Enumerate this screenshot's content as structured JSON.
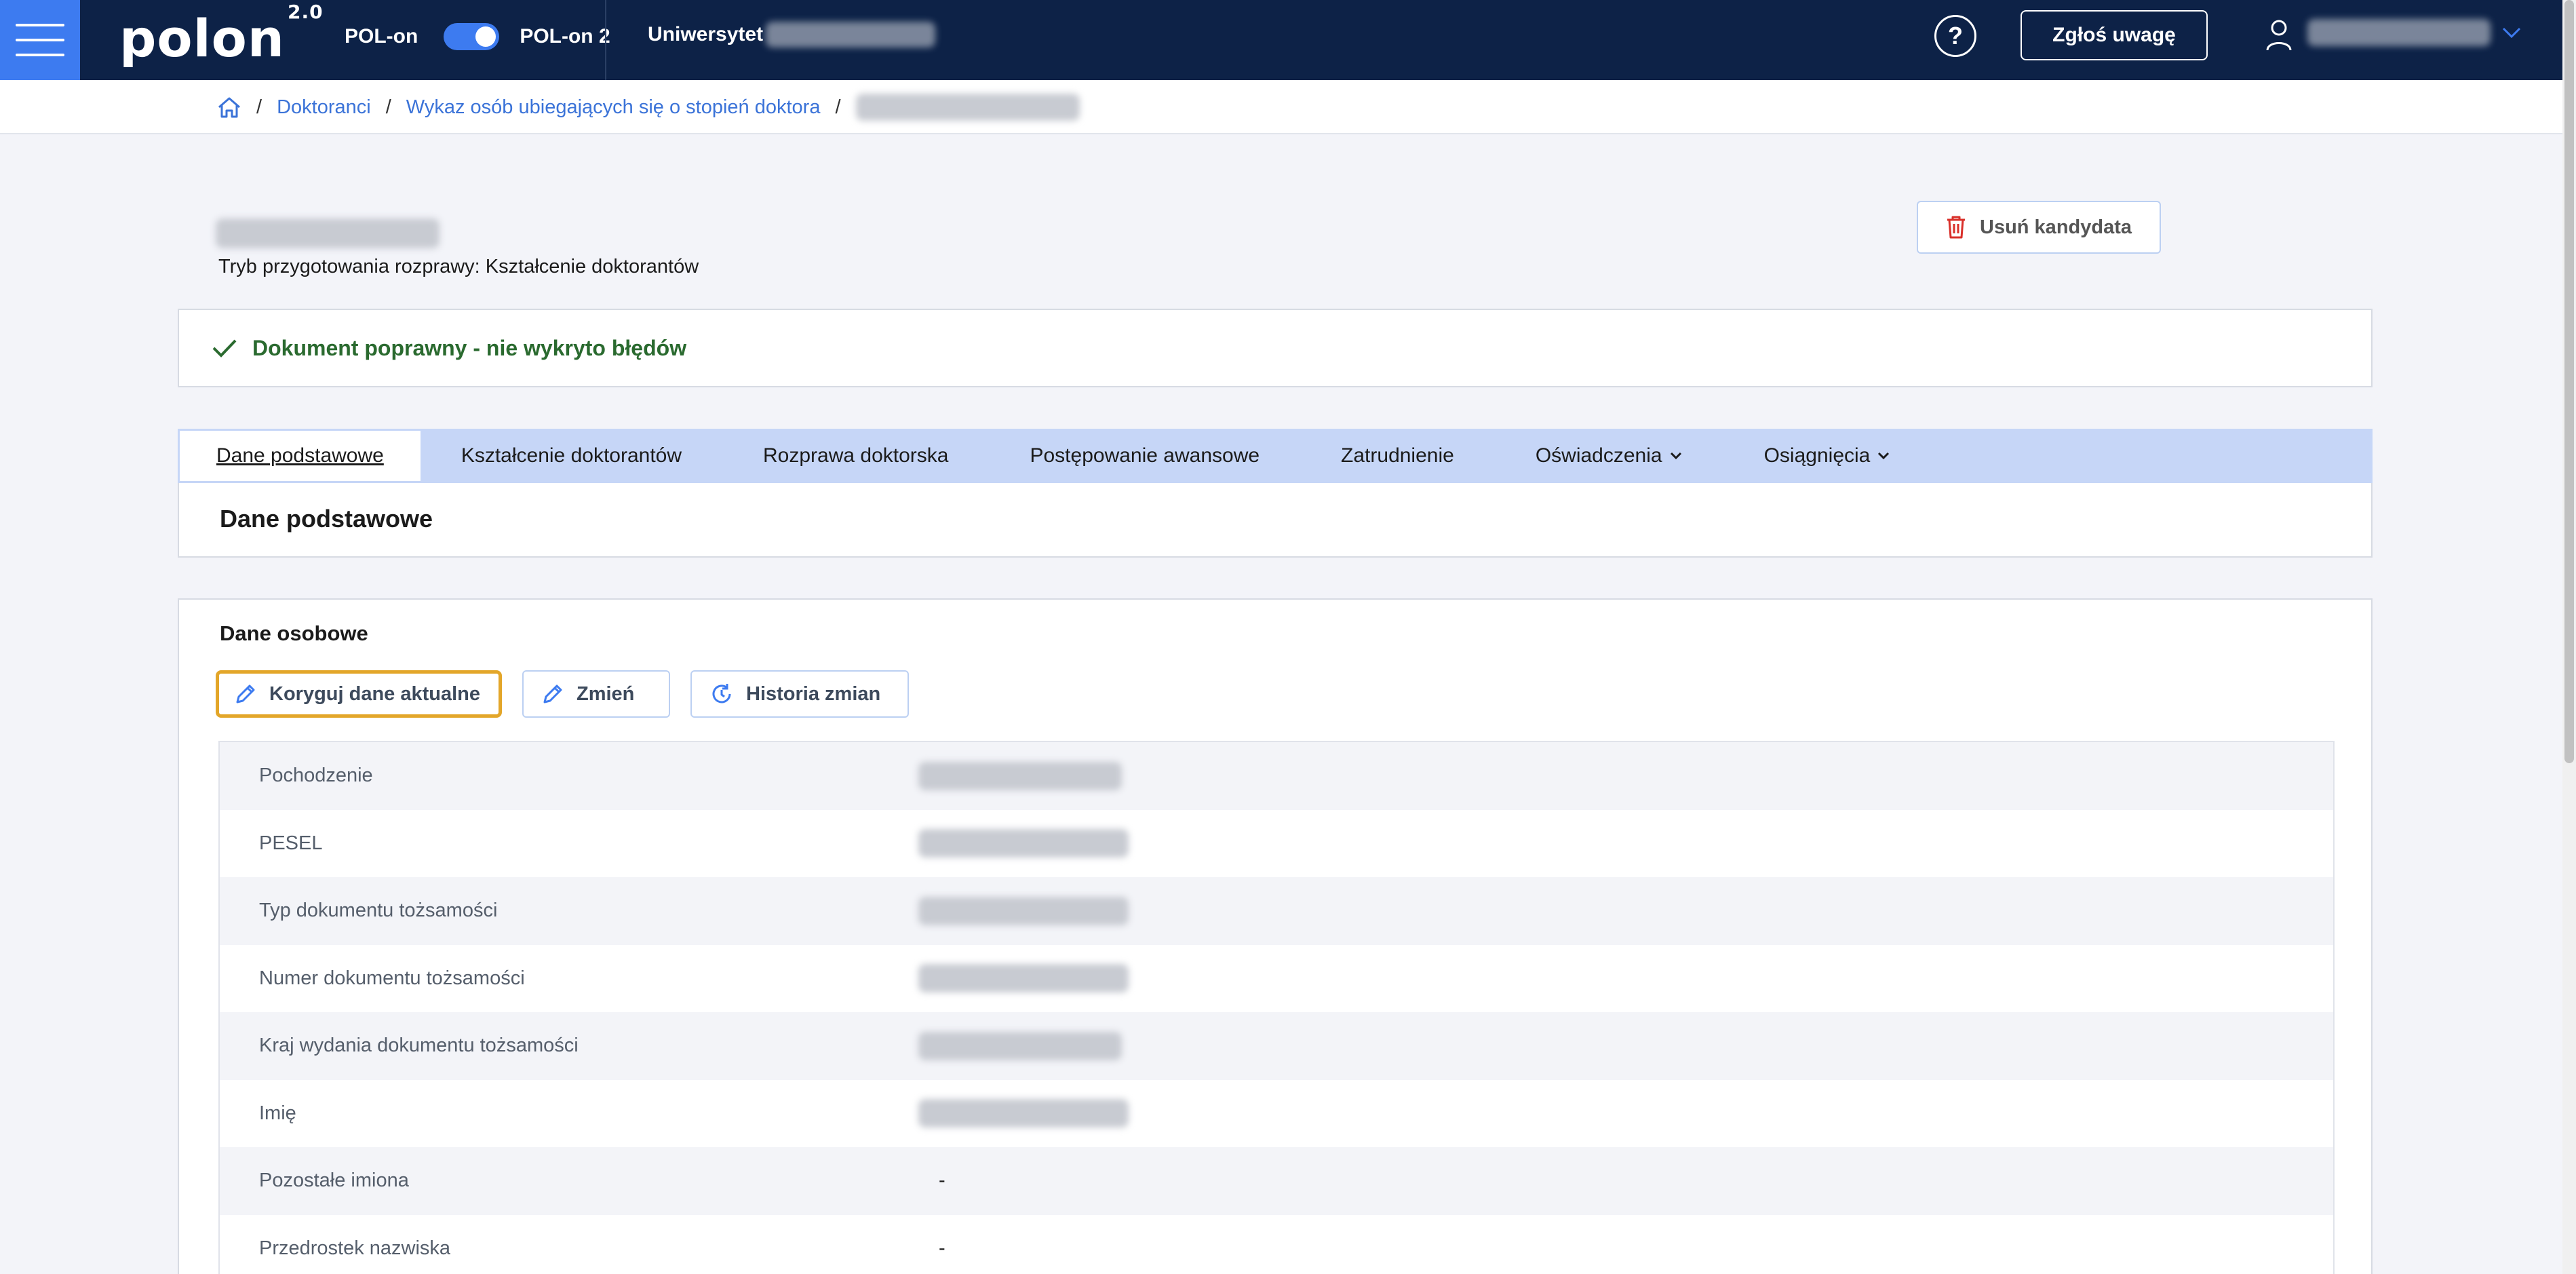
{
  "header": {
    "menu_icon": "hamburger-icon",
    "logo_text": "polon",
    "logo_version": "2.0",
    "env_left": "POL-on",
    "env_right": "POL-on 2",
    "university_label": "Uniwersytet",
    "help_label": "?",
    "report_button": "Zgłoś uwagę",
    "user_icon": "user-icon",
    "user_chevron_icon": "chevron-down-icon"
  },
  "breadcrumb": {
    "home_icon": "home-icon",
    "items": [
      "Doktoranci",
      "Wykaz osób ubiegających się o stopień doktora"
    ],
    "separator": "/"
  },
  "page": {
    "prep_mode": "Tryb przygotowania rozprawy: Kształcenie doktorantów",
    "delete_button": "Usuń kandydata",
    "delete_icon": "trash-icon"
  },
  "status": {
    "icon": "check-icon",
    "text": "Dokument poprawny - nie wykryto błędów",
    "color": "#2a6a2f"
  },
  "tabs": [
    {
      "label": "Dane podstawowe",
      "active": true
    },
    {
      "label": "Kształcenie doktorantów"
    },
    {
      "label": "Rozprawa doktorska"
    },
    {
      "label": "Postępowanie awansowe"
    },
    {
      "label": "Zatrudnienie"
    },
    {
      "label": "Oświadczenia",
      "dropdown": true
    },
    {
      "label": "Osiągnięcia",
      "dropdown": true
    }
  ],
  "section_title": "Dane podstawowe",
  "personal": {
    "title": "Dane osobowe",
    "buttons": {
      "correct": "Koryguj dane aktualne",
      "change": "Zmień",
      "history": "Historia zmian"
    },
    "rows": [
      {
        "label": "Pochodzenie",
        "value": null
      },
      {
        "label": "PESEL",
        "value": null
      },
      {
        "label": "Typ dokumentu tożsamości",
        "value": null
      },
      {
        "label": "Numer dokumentu tożsamości",
        "value": null
      },
      {
        "label": "Kraj wydania dokumentu tożsamości",
        "value": null
      },
      {
        "label": "Imię",
        "value": null
      },
      {
        "label": "Pozostałe imiona",
        "value": "-"
      },
      {
        "label": "Przedrostek nazwiska",
        "value": "-"
      }
    ]
  },
  "colors": {
    "topbar": "#0d2247",
    "accent": "#3d7bf0",
    "link": "#3b73d8",
    "tabs_bg": "#c6d6f7",
    "focus": "#e3a629",
    "danger": "#d9302a"
  }
}
